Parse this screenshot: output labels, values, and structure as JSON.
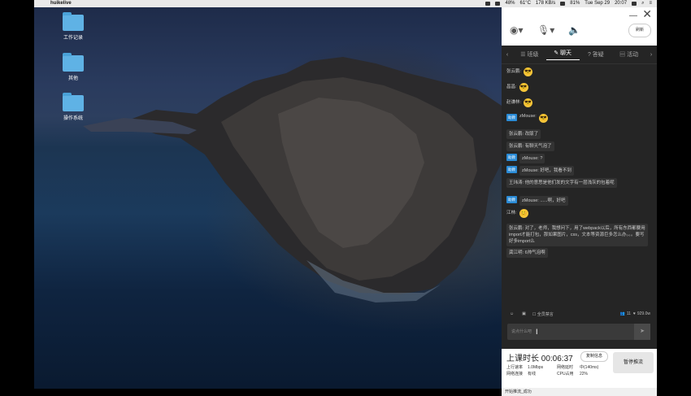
{
  "menubar": {
    "app_name": "huikelive",
    "status_items": [
      "48%",
      "61°C",
      "178 KB/s",
      "81%",
      "Tue Sep 29",
      "20:07"
    ]
  },
  "desktop": {
    "icons": [
      {
        "label": "工作记录",
        "icon": "folder-icon"
      },
      {
        "label": "其他",
        "icon": "folder-icon"
      },
      {
        "label": "操作系统",
        "icon": "folder-icon"
      }
    ]
  },
  "panel": {
    "refresh_label": "刷新",
    "tabs": [
      "班级",
      "聊天",
      "答疑",
      "活动"
    ],
    "active_tab": "聊天",
    "messages": [
      {
        "sender": "张云鹏:",
        "text": "",
        "emoji": "😎",
        "tag": ""
      },
      {
        "sender": "昌昌:",
        "text": "",
        "emoji": "😎",
        "tag": ""
      },
      {
        "sender": "赵谦林:",
        "text": "",
        "emoji": "😎",
        "tag": ""
      },
      {
        "sender": "zMouse:",
        "text": "",
        "emoji": "😎",
        "tag": "助教"
      },
      {
        "sender": "张云鹏:",
        "text": "改版了",
        "emoji": "",
        "tag": ""
      },
      {
        "sender": "张云鹏:",
        "text": "有聊天气泡了",
        "emoji": "",
        "tag": ""
      },
      {
        "sender": "zMouse:",
        "text": "?",
        "emoji": "",
        "tag": "助教"
      },
      {
        "sender": "zMouse:",
        "text": "好吧，我看不到",
        "emoji": "",
        "tag": "助教"
      },
      {
        "sender": "王玮涛:",
        "text": "他的意思是他们发的文字有一层浅灰的包着呢",
        "emoji": "",
        "tag": ""
      },
      {
        "sender": "zMouse:",
        "text": "......啊，好吧",
        "emoji": "",
        "tag": "助教"
      },
      {
        "sender": "江林:",
        "text": "",
        "emoji": "😊",
        "tag": ""
      },
      {
        "sender": "张云鹏:",
        "text": "对了，老师，我想问下，用了webpack以后，所有东西都要用import才能打包，那如果图片，css，文本等资源巨多怎么办。。。要写好多import么",
        "emoji": "",
        "tag": ""
      },
      {
        "sender": "龚江明:",
        "text": "6帅气泡啊",
        "emoji": "",
        "tag": ""
      }
    ],
    "mute_all_label": "全员禁言",
    "online_count": "11",
    "likes": "929.0w",
    "input_placeholder": "说点什么吧",
    "duration_label": "上课时长 00:06:37",
    "copy_button": "复制信息",
    "pause_button": "暂停推流",
    "stats": {
      "upload_label": "上行速率",
      "upload_value": "1.0Mbps",
      "latency_label": "网络延时",
      "latency_value": "中(140ms)",
      "network_label": "网络连接",
      "network_value": "有线",
      "cpu_label": "CPU占用",
      "cpu_value": "22%"
    },
    "status_text": "开始推流_成功"
  }
}
